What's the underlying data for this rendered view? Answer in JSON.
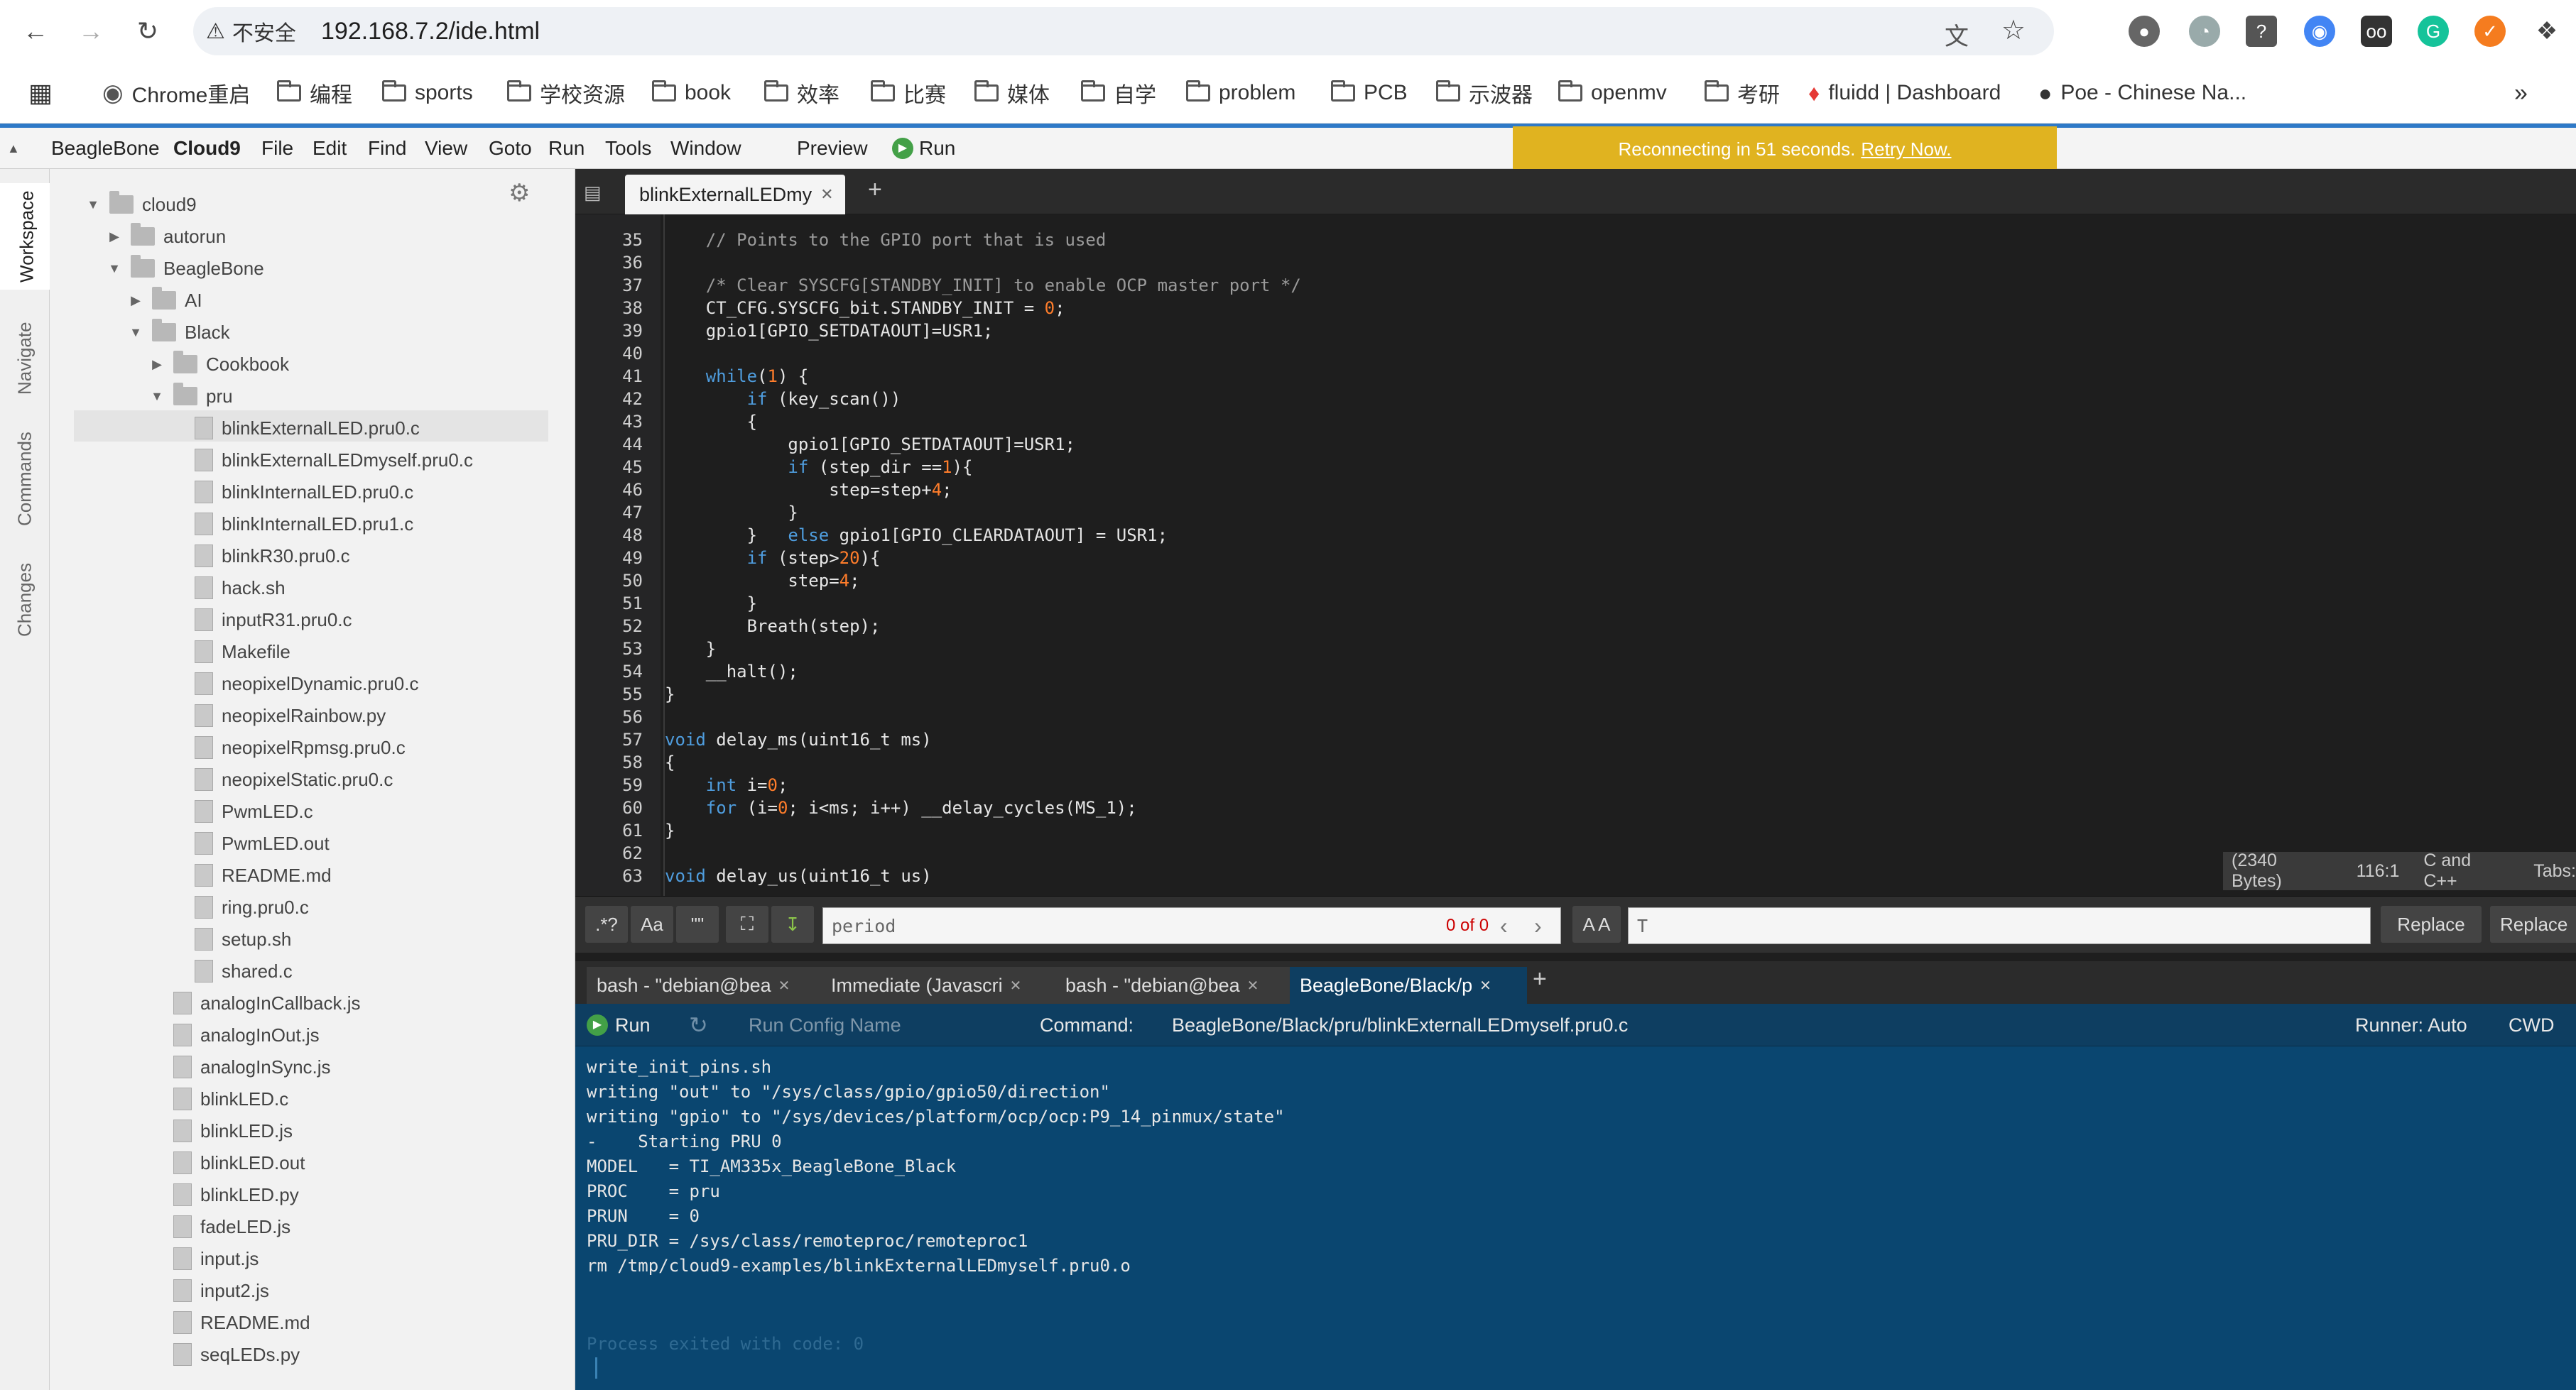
{
  "browser": {
    "security_label": "不安全",
    "url": "192.168.7.2/ide.html",
    "bookmarks": [
      {
        "label": "Chrome重启",
        "icon": "chrome-icon"
      },
      {
        "label": "编程",
        "icon": "folder-icon"
      },
      {
        "label": "sports",
        "icon": "folder-icon"
      },
      {
        "label": "学校资源",
        "icon": "folder-icon"
      },
      {
        "label": "book",
        "icon": "folder-icon"
      },
      {
        "label": "效率",
        "icon": "folder-icon"
      },
      {
        "label": "比赛",
        "icon": "folder-icon"
      },
      {
        "label": "媒体",
        "icon": "folder-icon"
      },
      {
        "label": "自学",
        "icon": "folder-icon"
      },
      {
        "label": "problem",
        "icon": "folder-icon"
      },
      {
        "label": "PCB",
        "icon": "folder-icon"
      },
      {
        "label": "示波器",
        "icon": "folder-icon"
      },
      {
        "label": "openmv",
        "icon": "folder-icon"
      },
      {
        "label": "考研",
        "icon": "folder-icon"
      },
      {
        "label": "fluidd | Dashboard",
        "icon": "fluidd-icon"
      },
      {
        "label": "Poe - Chinese Na...",
        "icon": "poe-icon"
      }
    ],
    "more": "»"
  },
  "ide": {
    "menu": [
      "BeagleBone",
      "Cloud9",
      "File",
      "Edit",
      "Find",
      "View",
      "Goto",
      "Run",
      "Tools",
      "Window"
    ],
    "preview": "Preview",
    "run": "Run",
    "banner": {
      "text": "Reconnecting in 51 seconds.",
      "link": "Retry Now."
    },
    "vtabs": [
      "Workspace",
      "Navigate",
      "Commands",
      "Changes"
    ],
    "tree": [
      {
        "label": "cloud9",
        "type": "dir",
        "depth": 0,
        "open": true
      },
      {
        "label": "autorun",
        "type": "dir",
        "depth": 1,
        "open": false
      },
      {
        "label": "BeagleBone",
        "type": "dir",
        "depth": 1,
        "open": true
      },
      {
        "label": "AI",
        "type": "dir",
        "depth": 2,
        "open": false
      },
      {
        "label": "Black",
        "type": "dir",
        "depth": 2,
        "open": true
      },
      {
        "label": "Cookbook",
        "type": "dir",
        "depth": 3,
        "open": false
      },
      {
        "label": "pru",
        "type": "dir",
        "depth": 3,
        "open": true
      },
      {
        "label": "blinkExternalLED.pru0.c",
        "type": "file",
        "depth": 4
      },
      {
        "label": "blinkExternalLEDmyself.pru0.c",
        "type": "file",
        "depth": 4
      },
      {
        "label": "blinkInternalLED.pru0.c",
        "type": "file",
        "depth": 4
      },
      {
        "label": "blinkInternalLED.pru1.c",
        "type": "file",
        "depth": 4
      },
      {
        "label": "blinkR30.pru0.c",
        "type": "file",
        "depth": 4
      },
      {
        "label": "hack.sh",
        "type": "file",
        "depth": 4
      },
      {
        "label": "inputR31.pru0.c",
        "type": "file",
        "depth": 4
      },
      {
        "label": "Makefile",
        "type": "file",
        "depth": 4
      },
      {
        "label": "neopixelDynamic.pru0.c",
        "type": "file",
        "depth": 4
      },
      {
        "label": "neopixelRainbow.py",
        "type": "file",
        "depth": 4
      },
      {
        "label": "neopixelRpmsg.pru0.c",
        "type": "file",
        "depth": 4
      },
      {
        "label": "neopixelStatic.pru0.c",
        "type": "file",
        "depth": 4
      },
      {
        "label": "PwmLED.c",
        "type": "file",
        "depth": 4
      },
      {
        "label": "PwmLED.out",
        "type": "file",
        "depth": 4
      },
      {
        "label": "README.md",
        "type": "file",
        "depth": 4
      },
      {
        "label": "ring.pru0.c",
        "type": "file",
        "depth": 4
      },
      {
        "label": "setup.sh",
        "type": "file",
        "depth": 4
      },
      {
        "label": "shared.c",
        "type": "file",
        "depth": 4
      },
      {
        "label": "analogInCallback.js",
        "type": "file",
        "depth": 3
      },
      {
        "label": "analogInOut.js",
        "type": "file",
        "depth": 3
      },
      {
        "label": "analogInSync.js",
        "type": "file",
        "depth": 3
      },
      {
        "label": "blinkLED.c",
        "type": "file",
        "depth": 3
      },
      {
        "label": "blinkLED.js",
        "type": "file",
        "depth": 3
      },
      {
        "label": "blinkLED.out",
        "type": "file",
        "depth": 3
      },
      {
        "label": "blinkLED.py",
        "type": "file",
        "depth": 3
      },
      {
        "label": "fadeLED.js",
        "type": "file",
        "depth": 3
      },
      {
        "label": "input.js",
        "type": "file",
        "depth": 3
      },
      {
        "label": "input2.js",
        "type": "file",
        "depth": 3
      },
      {
        "label": "README.md",
        "type": "file",
        "depth": 3
      },
      {
        "label": "seqLEDs.py",
        "type": "file",
        "depth": 3
      }
    ],
    "editor_tab": "blinkExternalLEDmy",
    "code_lines": [
      {
        "n": "35",
        "html": "    <span class='cm'>// Points to the GPIO port that is used</span>"
      },
      {
        "n": "36",
        "html": ""
      },
      {
        "n": "37",
        "html": "    <span class='cm'>/* Clear SYSCFG[STANDBY_INIT] to enable OCP master port */</span>"
      },
      {
        "n": "38",
        "html": "    CT_CFG.SYSCFG_bit.STANDBY_INIT = <span class='num'>0</span>;"
      },
      {
        "n": "39",
        "html": "    gpio1[GPIO_SETDATAOUT]=USR1;"
      },
      {
        "n": "40",
        "html": ""
      },
      {
        "n": "41",
        "html": "    <span class='kw'>while</span>(<span class='num'>1</span>) {"
      },
      {
        "n": "42",
        "html": "        <span class='kw'>if</span> (key_scan())"
      },
      {
        "n": "43",
        "html": "        {"
      },
      {
        "n": "44",
        "html": "            gpio1[GPIO_SETDATAOUT]=USR1;"
      },
      {
        "n": "45",
        "html": "            <span class='kw'>if</span> (step_dir ==<span class='num'>1</span>){"
      },
      {
        "n": "46",
        "html": "                step=step+<span class='num'>4</span>;"
      },
      {
        "n": "47",
        "html": "            }"
      },
      {
        "n": "48",
        "html": "        }   <span class='kw'>else</span> gpio1[GPIO_CLEARDATAOUT] = USR1;"
      },
      {
        "n": "49",
        "html": "        <span class='kw'>if</span> (step><span class='num'>20</span>){"
      },
      {
        "n": "50",
        "html": "            step=<span class='num'>4</span>;"
      },
      {
        "n": "51",
        "html": "        }"
      },
      {
        "n": "52",
        "html": "        Breath(step);"
      },
      {
        "n": "53",
        "html": "    }"
      },
      {
        "n": "54",
        "html": "    __halt();"
      },
      {
        "n": "55",
        "html": "}"
      },
      {
        "n": "56",
        "html": ""
      },
      {
        "n": "57",
        "html": "<span class='kw'>void</span> delay_ms(uint16_t ms)"
      },
      {
        "n": "58",
        "html": "{"
      },
      {
        "n": "59",
        "html": "    <span class='kw'>int</span> i=<span class='num'>0</span>;"
      },
      {
        "n": "60",
        "html": "    <span class='kw'>for</span> (i=<span class='num'>0</span>; i&lt;ms; i++) __delay_cycles(MS_1);"
      },
      {
        "n": "61",
        "html": "}"
      },
      {
        "n": "62",
        "html": ""
      },
      {
        "n": "63",
        "html": "<span class='kw'>void</span> delay_us(uint16_t us)"
      }
    ],
    "status": {
      "bytes": "(2340 Bytes)",
      "cursor": "116:1",
      "mode": "C and C++",
      "tabs": "Tabs:"
    },
    "find": {
      "regex": ".*?",
      "case": "Aa",
      "word": "\"\"",
      "value": "period",
      "count": "0 of 0",
      "replace_value": "T",
      "replace": "Replace",
      "replace_all": "Replace",
      "aa": "A A"
    },
    "term_tabs": [
      "bash - \"debian@bea",
      "Immediate (Javascri",
      "bash - \"debian@bea",
      "BeagleBone/Black/p"
    ],
    "runbar": {
      "run": "Run",
      "config": "Run Config Name",
      "command_label": "Command:",
      "command": "BeagleBone/Black/pru/blinkExternalLEDmyself.pru0.c",
      "runner": "Runner: Auto",
      "cwd": "CWD"
    },
    "terminal": [
      "write_init_pins.sh",
      "writing \"out\" to \"/sys/class/gpio/gpio50/direction\"",
      "writing \"gpio\" to \"/sys/devices/platform/ocp/ocp:P9_14_pinmux/state\"",
      "-    Starting PRU 0",
      "MODEL   = TI_AM335x_BeagleBone_Black",
      "PROC    = pru",
      "PRUN    = 0",
      "PRU_DIR = /sys/class/remoteproc/remoteproc1",
      "rm /tmp/cloud9-examples/blinkExternalLEDmyself.pru0.o"
    ],
    "process_exit": "Process exited with code: 0"
  }
}
